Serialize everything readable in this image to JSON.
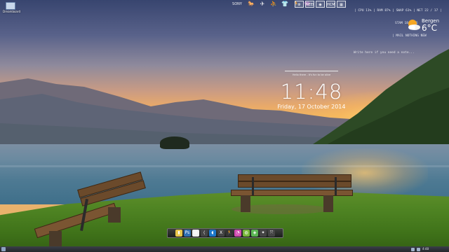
{
  "desktop_icon": {
    "label": "Dreamboard",
    "icon": "monitor-icon"
  },
  "top_launcher": [
    {
      "name": "sony-logo-icon",
      "glyph": "SONY"
    },
    {
      "name": "mustang-logo-icon",
      "glyph": "🐎"
    },
    {
      "name": "jet-icon",
      "glyph": "✈"
    },
    {
      "name": "basketball-player-icon",
      "glyph": "⛹"
    },
    {
      "name": "shirt-icon",
      "glyph": "👕"
    },
    {
      "name": "runner-icon",
      "glyph": "🏃"
    },
    {
      "name": "arcade-invader-icon",
      "glyph": "👾"
    }
  ],
  "top_boxes": [
    {
      "name": "settings-box-icon",
      "glyph": "⚙"
    },
    {
      "name": "need-box-icon",
      "glyph": "NEED"
    },
    {
      "name": "camera-box-icon",
      "glyph": "◉"
    },
    {
      "name": "text-box-icon",
      "glyph": "HCM"
    },
    {
      "name": "grid-box-icon",
      "glyph": "▦"
    }
  ],
  "system_monitor": {
    "line1": "| CPU 11% | RAM 87% | SWAP 61% | NET 22 / 17 |",
    "line2": "STAM 18 4/46",
    "line3": "| MAIL NOTHING NEW"
  },
  "weather": {
    "city": "Bergen",
    "temp": "6°C",
    "icon": "partly-cloudy-icon"
  },
  "clock": {
    "label": "Hello there - It's fun to be alive",
    "time": "11:48",
    "date": "Friday, 17 October 2014"
  },
  "note": {
    "text": "Write here if you need a note..."
  },
  "dock_items": [
    {
      "name": "folder-icon",
      "glyph": "▮",
      "color": "#e8c64a"
    },
    {
      "name": "photoshop-icon",
      "glyph": "Ps",
      "color": "#2f6fb3"
    },
    {
      "name": "document-icon",
      "glyph": "▤",
      "color": "#f0f0f0"
    },
    {
      "name": "share-icon",
      "glyph": "⟨",
      "color": "#444"
    },
    {
      "name": "app-blue-icon",
      "glyph": "◖",
      "color": "#1c77c9"
    },
    {
      "name": "x-icon",
      "glyph": "X",
      "color": "#444"
    },
    {
      "name": "runner-icon",
      "glyph": "🏃",
      "color": "#333"
    },
    {
      "name": "color-wheel-icon",
      "glyph": "◔",
      "color": "#d04bb0"
    },
    {
      "name": "android-icon",
      "glyph": "◍",
      "color": "#79b83a"
    },
    {
      "name": "green-app-icon",
      "glyph": "◈",
      "color": "#5ab552"
    },
    {
      "name": "controller-icon",
      "glyph": "✦",
      "color": "#444"
    },
    {
      "name": "arrows-icon",
      "glyph": "⤧",
      "color": "#444"
    }
  ],
  "taskbar": {
    "time": "4:48"
  },
  "colors": {
    "accent": "#ffffff"
  }
}
